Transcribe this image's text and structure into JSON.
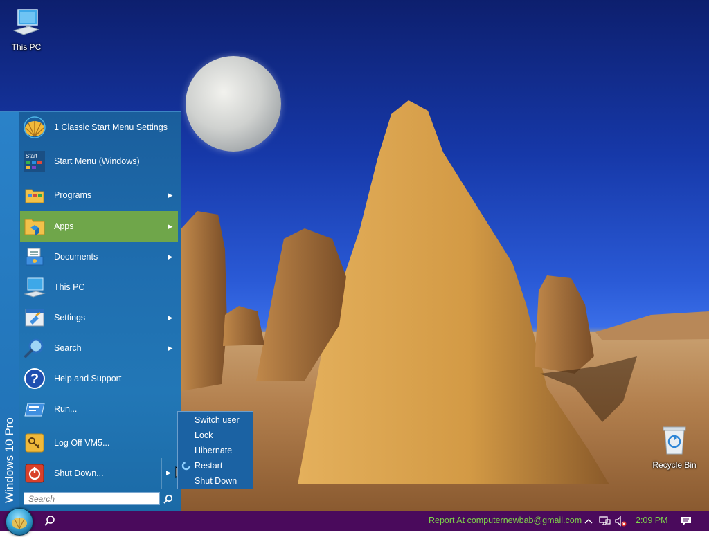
{
  "desktop": {
    "icons": [
      {
        "label": "This PC",
        "icon": "monitor-icon"
      },
      {
        "label": "Recycle Bin",
        "icon": "recycle-bin-icon"
      }
    ]
  },
  "start_menu": {
    "banner": "Windows 10 Pro",
    "items": [
      {
        "label": "1 Classic Start Menu Settings",
        "icon": "shell-icon",
        "submenu": false
      },
      {
        "label": "Start Menu (Windows)",
        "icon": "start-tile-icon",
        "submenu": false
      },
      {
        "label": "Programs",
        "icon": "folder-icon",
        "submenu": true
      },
      {
        "label": "Apps",
        "icon": "apps-folder-icon",
        "submenu": true,
        "active": true
      },
      {
        "label": "Documents",
        "icon": "documents-icon",
        "submenu": true
      },
      {
        "label": "This PC",
        "icon": "computer-icon",
        "submenu": false
      },
      {
        "label": "Settings",
        "icon": "settings-icon",
        "submenu": true
      },
      {
        "label": "Search",
        "icon": "search-icon",
        "submenu": true
      },
      {
        "label": "Help and Support",
        "icon": "help-icon",
        "submenu": false
      },
      {
        "label": "Run...",
        "icon": "run-icon",
        "submenu": false
      },
      {
        "label": "Log Off VM5...",
        "icon": "key-icon",
        "submenu": false
      },
      {
        "label": "Shut Down...",
        "icon": "power-icon",
        "submenu": true
      }
    ],
    "search_placeholder": "Search"
  },
  "shutdown_submenu": {
    "items": [
      "Switch user",
      "Lock",
      "Hibernate",
      "Restart",
      "Shut Down"
    ],
    "selected": "Restart"
  },
  "taskbar": {
    "report_text": "Report At computernewbab@gmail.com",
    "clock": "2:09 PM",
    "tray_icons": [
      "chevron-up-icon",
      "network-icon",
      "volume-muted-icon",
      "notifications-icon"
    ]
  },
  "colors": {
    "menu_bg": "#1f6eaf",
    "highlight": "#6fa64a",
    "taskbar": "#4a0a5c",
    "tray_text": "#7dd34a"
  }
}
